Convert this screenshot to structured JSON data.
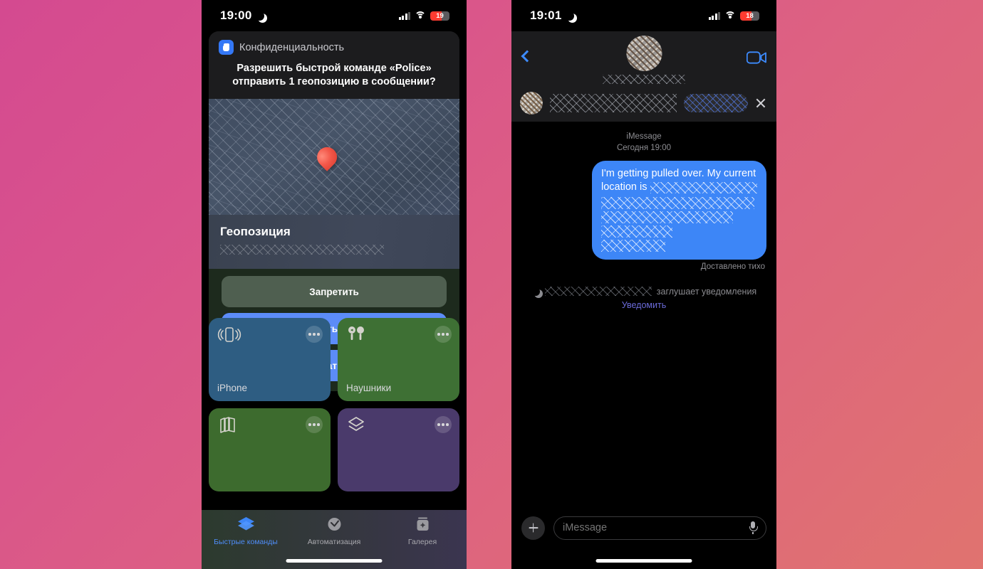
{
  "background": {
    "from": "#d44a90",
    "to": "#e0736f"
  },
  "phone_left": {
    "status": {
      "time": "19:00",
      "battery": "19",
      "moon_icon": "crescent-moon-icon",
      "wifi_icon": "wifi-icon",
      "cellular_icon": "cellular-bars-icon"
    },
    "dialog": {
      "app_icon": "privacy-hand-icon",
      "app_name": "Конфиденциальность",
      "question": "Разрешить быстрой команде «Police» отправить 1 геопозицию в сообщении?",
      "map": {
        "pin_icon": "map-pin-icon",
        "redacted": true
      },
      "location": {
        "title": "Геопозиция",
        "address_redacted": true
      },
      "buttons": [
        {
          "label": "Запретить",
          "style": "deny"
        },
        {
          "label": "Разрешить один раз",
          "style": "allow"
        },
        {
          "label": "Разрешать всегда",
          "style": "allow"
        }
      ]
    },
    "tiles": [
      {
        "label": "iPhone",
        "color": "#2e5d82",
        "icon": "iphone-vibrate-icon",
        "menu_icon": "ellipsis-icon"
      },
      {
        "label": "Наушники",
        "color": "#3e7034",
        "icon": "airpods-icon",
        "menu_icon": "ellipsis-icon"
      },
      {
        "label": "",
        "color": "#3d6b2e",
        "icon": "books-stack-icon",
        "menu_icon": "ellipsis-icon"
      },
      {
        "label": "",
        "color": "#4a3a6b",
        "icon": "shortcuts-layers-icon",
        "menu_icon": "ellipsis-icon"
      }
    ],
    "tabs": [
      {
        "label": "Быстрые команды",
        "icon": "shortcuts-icon",
        "active": true
      },
      {
        "label": "Автоматизация",
        "icon": "automation-clock-icon",
        "active": false
      },
      {
        "label": "Галерея",
        "icon": "gallery-icon",
        "active": false
      }
    ]
  },
  "phone_right": {
    "status": {
      "time": "19:01",
      "battery": "18",
      "moon_icon": "crescent-moon-icon",
      "wifi_icon": "wifi-icon",
      "cellular_icon": "cellular-bars-icon"
    },
    "header": {
      "back_icon": "back-chevron-icon",
      "avatar": "contact-avatar",
      "contact_name_redacted": true,
      "facetime_icon": "video-camera-icon"
    },
    "banner": {
      "avatar": "banner-avatar",
      "text_redacted": true,
      "action_pill_redacted": true,
      "close_icon": "close-x-icon"
    },
    "conversation": {
      "service": "iMessage",
      "date": "Сегодня 19:00",
      "message": "I'm getting pulled over. My current location is",
      "message_address_redacted": true,
      "delivery_status": "Доставлено тихо"
    },
    "focus": {
      "moon_icon": "crescent-moon-icon",
      "name_redacted": true,
      "text": "заглушает уведомления",
      "notify_link": "Уведомить"
    },
    "input": {
      "plus_icon": "plus-icon",
      "placeholder": "iMessage",
      "value": "",
      "mic_icon": "microphone-icon"
    }
  }
}
